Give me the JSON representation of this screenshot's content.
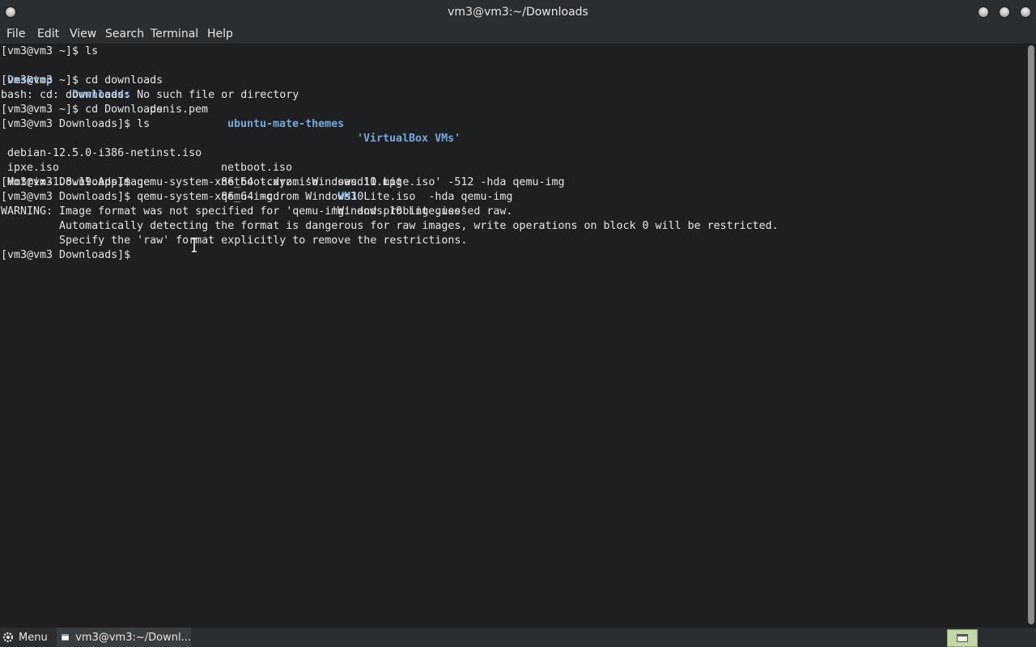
{
  "window": {
    "title": "vm3@vm3:~/Downloads"
  },
  "menubar": {
    "items": [
      "File",
      "Edit",
      "View",
      "Search",
      "Terminal",
      "Help"
    ]
  },
  "terminal": {
    "lines": [
      "[vm3@vm3 ~]$ ls",
      "",
      "[vm3@vm3 ~]$ cd downloads",
      "bash: cd: downloads: No such file or directory",
      "[vm3@vm3 ~]$ cd Downloads",
      "[vm3@vm3 Downloads]$ ls",
      "",
      "",
      "",
      "[vm3@vm3 Downloads]$ qemu-system-x86_64 -cdrom 'Windows 10 Lite.iso' -512 -hda qemu-img",
      "[vm3@vm3 Downloads]$ qemu-system-x86_64 -cdrom Windows10Lite.iso  -hda qemu-img",
      "WARNING: Image format was not specified for 'qemu-img' and probing guessed raw.",
      "         Automatically detecting the format is dangerous for raw images, write operations on block 0 will be restricted.",
      "         Specify the 'raw' format explicitly to remove the restrictions.",
      "[vm3@vm3 Downloads]$ "
    ],
    "home_ls": [
      {
        "name": "Desktop",
        "dir": true
      },
      {
        "name": "Downloads",
        "dir": true
      },
      {
        "name": "penis.pem",
        "dir": false
      },
      {
        "name": "ubuntu-mate-themes",
        "dir": true
      },
      {
        "name": "'VirtualBox VMs'",
        "dir": true
      }
    ],
    "downloads_ls": [
      [
        {
          "name": "debian-12.5.0-i386-netinst.iso",
          "dir": false
        },
        {
          "name": "netboot.iso",
          "dir": false
        },
        {
          "name": "saudi1.mpg",
          "dir": false
        }
      ],
      [
        {
          "name": "ipxe.iso",
          "dir": false
        },
        {
          "name": "netboot.xyz.iso",
          "dir": false
        },
        {
          "name": "VM3",
          "dir": true
        }
      ],
      [
        {
          "name": "Motrix-1.8.19.AppImage",
          "dir": false
        },
        {
          "name": "qemu-img",
          "dir": false
        },
        {
          "name": "'Windows 10 Lite.iso'",
          "dir": false
        }
      ]
    ]
  },
  "taskbar": {
    "menu_label": "Menu",
    "task_label": "vm3@vm3:~/Downl..."
  },
  "colors": {
    "background": "#1d1f21",
    "text": "#e6e6e6",
    "directory": "#76a8dc"
  }
}
